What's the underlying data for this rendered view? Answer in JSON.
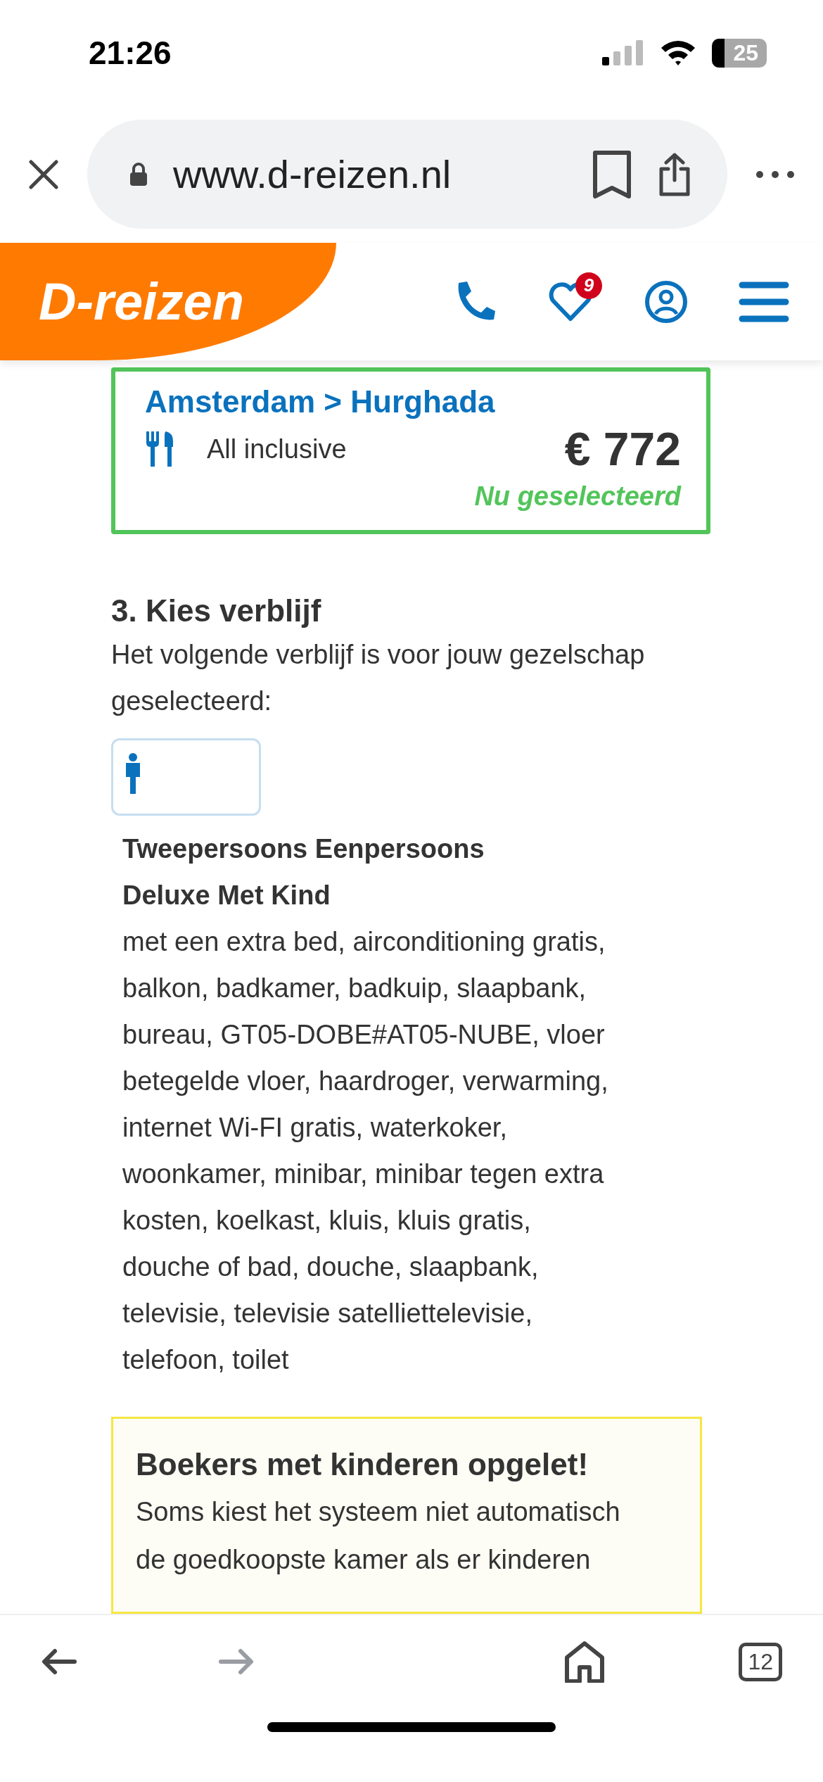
{
  "status_bar": {
    "time": "21:26",
    "battery": "25"
  },
  "browser": {
    "url": "www.d-reizen.nl"
  },
  "site_header": {
    "logo": "D-reizen",
    "favorites_count": "9"
  },
  "flight_card": {
    "route": "Amsterdam > Hurghada",
    "board": "All inclusive",
    "price": "€ 772",
    "status": "Nu geselecteerd",
    "selected": true
  },
  "stay": {
    "heading": "3. Kies verblijf",
    "intro": "Het volgende verblijf is voor jouw gezelschap geselecteerd:"
  },
  "room": {
    "title": "Tweepersoons Eenpersoons Deluxe Met Kind",
    "description": "met een extra bed, airconditioning gratis, balkon, badkamer, badkuip, slaapbank, bureau, GT05-DOBE#AT05-NUBE, vloer betegelde vloer, haardroger, verwarming, internet Wi-FI gratis, waterkoker, woonkamer, minibar, minibar tegen extra kosten, koelkast, kluis, kluis gratis, douche of bad, douche, slaapbank, televisie, televisie satelliettelevisie, telefoon, toilet"
  },
  "notice": {
    "title": "Boekers met kinderen opgelet!",
    "text": "Soms kiest het systeem niet automatisch de goedkoopste kamer als er kinderen"
  },
  "bottom_bar": {
    "tab_count": "12"
  }
}
